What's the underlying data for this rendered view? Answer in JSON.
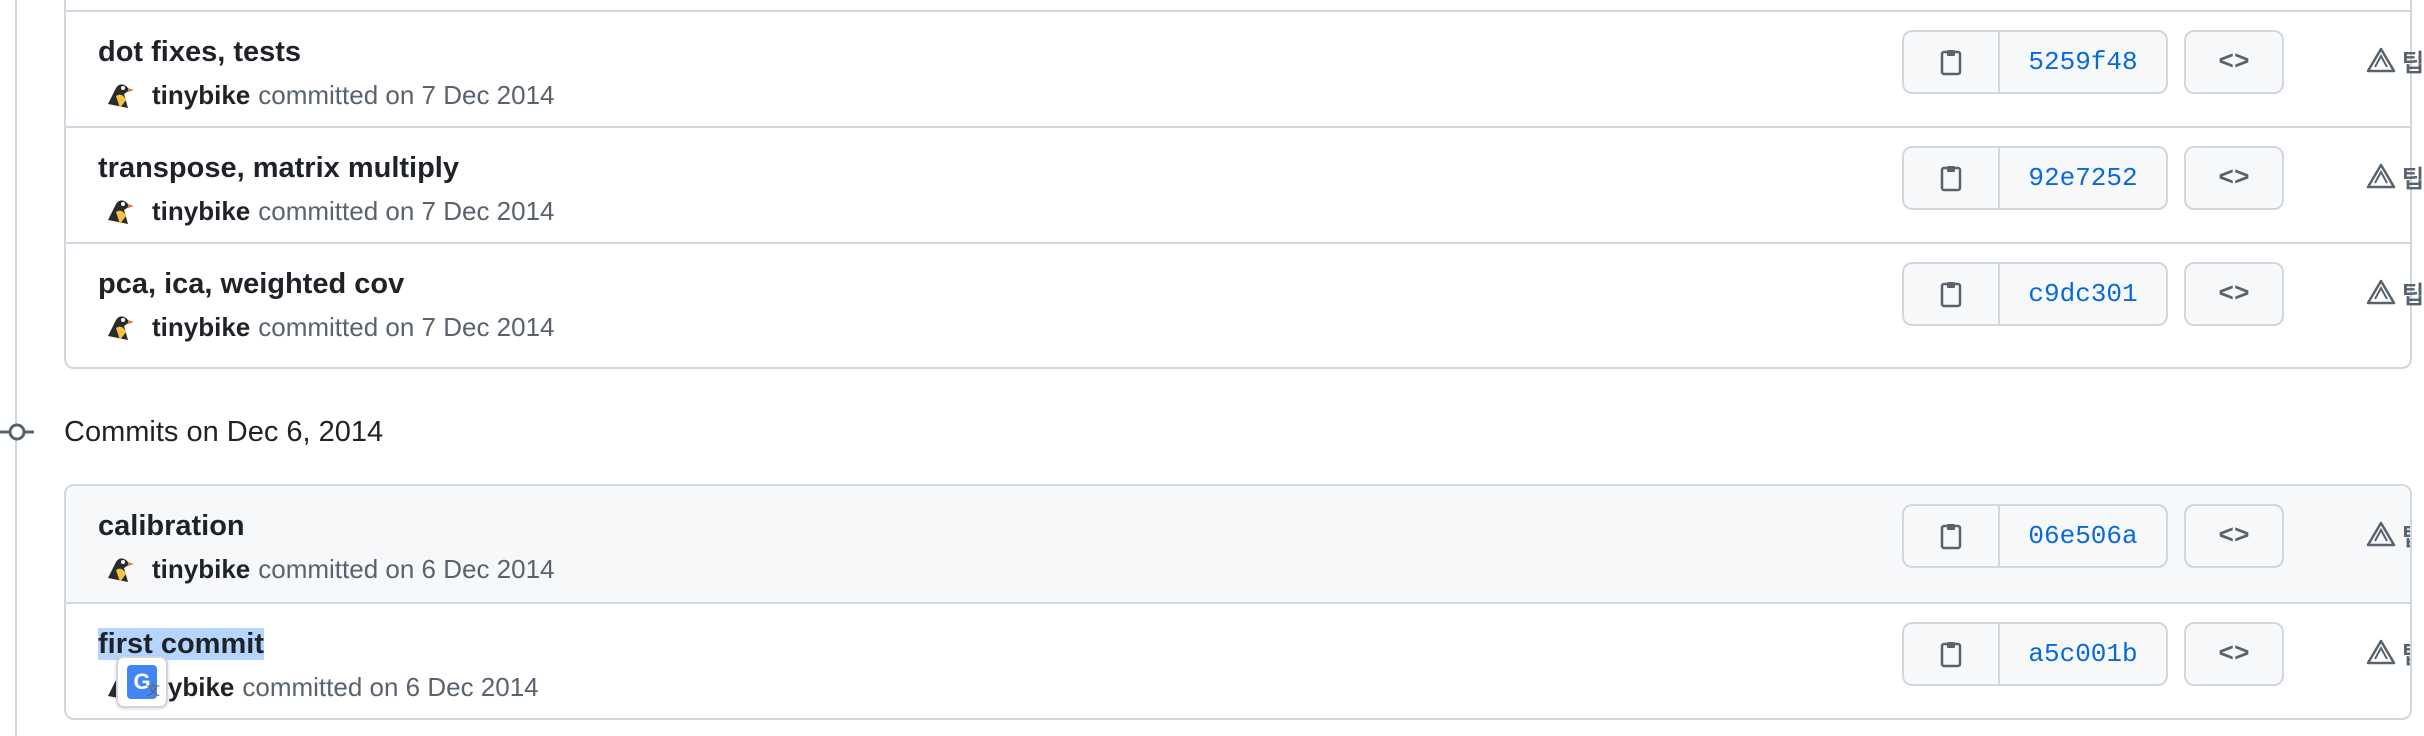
{
  "group_top": {
    "commits": [
      {
        "title": "dot fixes, tests",
        "author": "tinybike",
        "meta": "committed on 7 Dec 2014",
        "sha": "5259f48",
        "browse_label": "<>",
        "tip_label": "팁"
      },
      {
        "title": "transpose, matrix multiply",
        "author": "tinybike",
        "meta": "committed on 7 Dec 2014",
        "sha": "92e7252",
        "browse_label": "<>",
        "tip_label": "팁"
      },
      {
        "title": "pca, ica, weighted cov",
        "author": "tinybike",
        "meta": "committed on 7 Dec 2014",
        "sha": "c9dc301",
        "browse_label": "<>",
        "tip_label": "팁"
      }
    ]
  },
  "group_dec6": {
    "header": "Commits on Dec 6, 2014",
    "commits": [
      {
        "title": "calibration",
        "author": "tinybike",
        "meta": "committed on 6 Dec 2014",
        "sha": "06e506a",
        "browse_label": "<>",
        "tip_label": "팁"
      },
      {
        "title": "first commit",
        "author": "nybike",
        "meta": "committed on 6 Dec 2014",
        "sha": "a5c001b",
        "browse_label": "<>",
        "tip_label": "팁"
      }
    ]
  },
  "translate_badge": {
    "icon": "google-translate-icon",
    "letter": "G",
    "small": "文"
  },
  "colors": {
    "border": "#d0d7de",
    "link": "#0969da",
    "muted": "#59636e",
    "selection": "#b4d5fe",
    "hover_bg": "#f6f8fa"
  }
}
